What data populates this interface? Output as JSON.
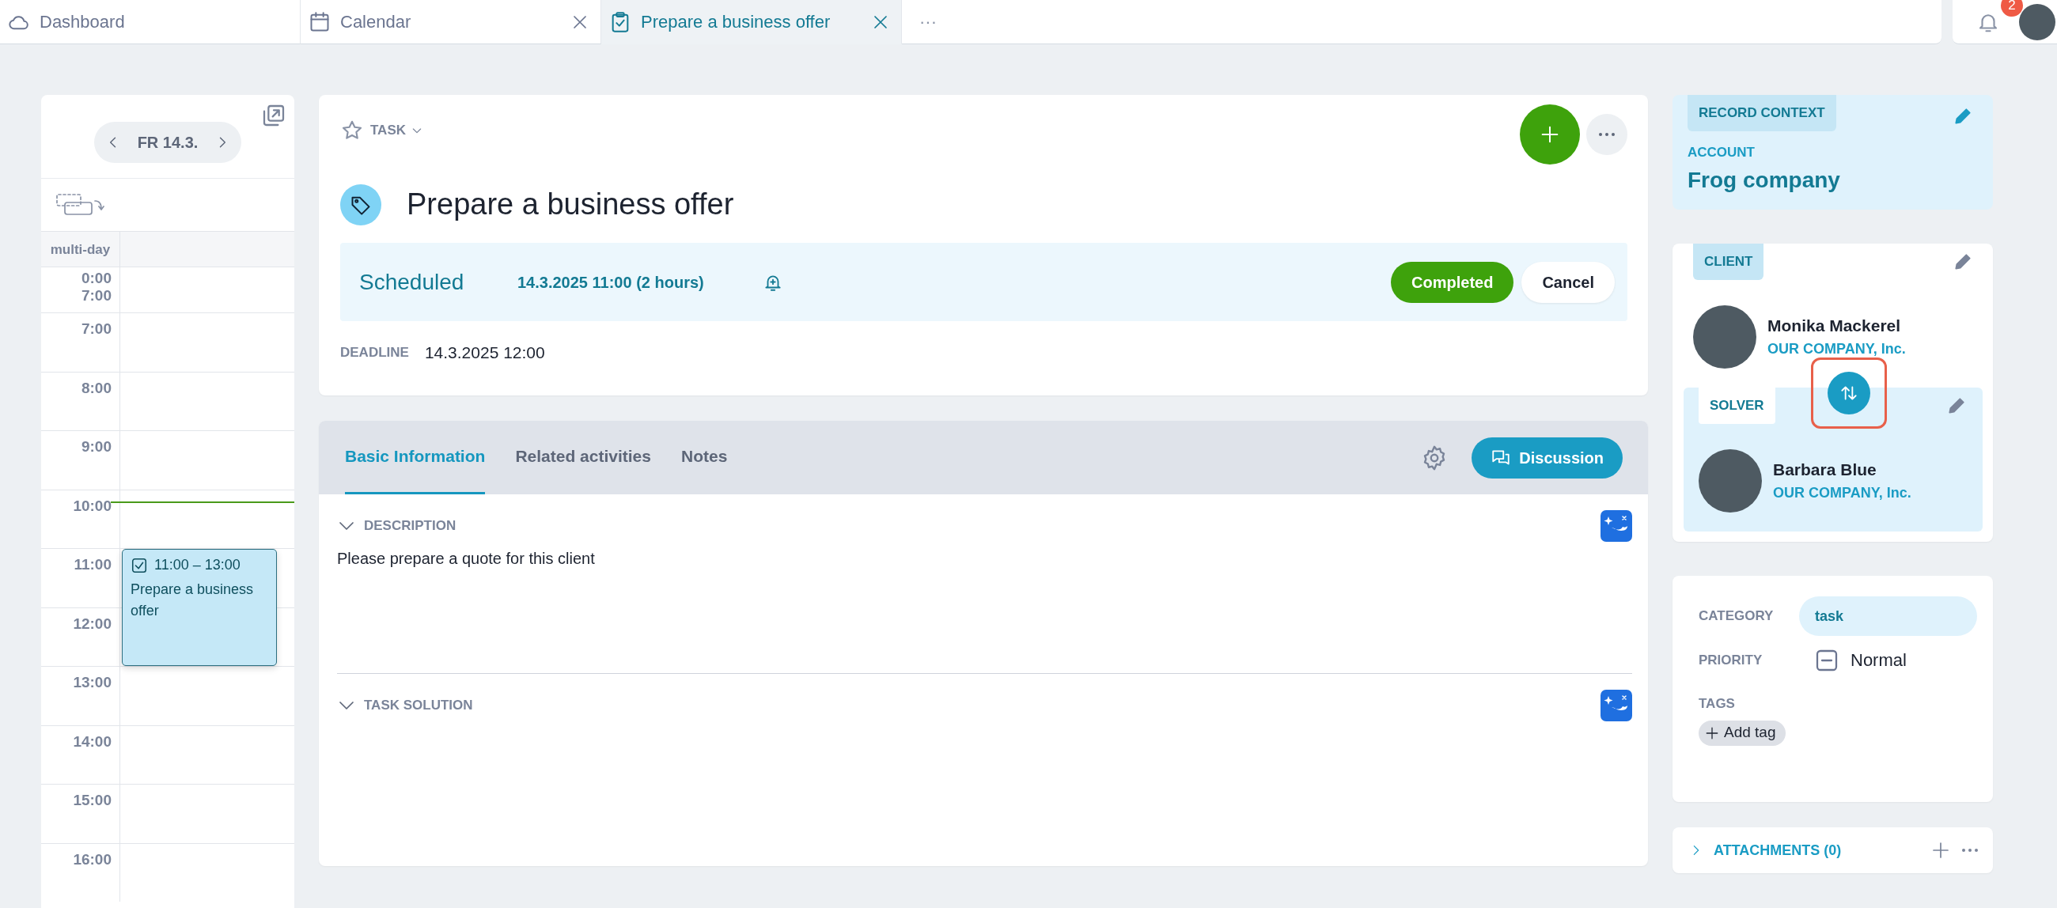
{
  "tabs": [
    {
      "label": "Dashboard",
      "kind": "dashboard",
      "closable": false,
      "selected": false
    },
    {
      "label": "Calendar",
      "kind": "calendar",
      "closable": true,
      "selected": false
    },
    {
      "label": "Prepare a business offer",
      "kind": "task",
      "closable": true,
      "selected": true
    }
  ],
  "more_tabs": "···",
  "notifications": {
    "count": "2"
  },
  "calendar": {
    "date": "FR 14.3.",
    "multi_day_label": "multi-day",
    "collapsed_labels": [
      "0:00",
      "7:00"
    ],
    "hours": [
      {
        "label": "7:00",
        "now": false
      },
      {
        "label": "8:00",
        "now": false
      },
      {
        "label": "9:00",
        "now": false
      },
      {
        "label": "10:00",
        "now": true
      },
      {
        "label": "11:00",
        "now": false,
        "events": [
          {
            "time": "11:00 – 13:00",
            "title": "Prepare a business offer"
          }
        ]
      },
      {
        "label": "12:00",
        "now": false
      },
      {
        "label": "13:00",
        "now": false
      },
      {
        "label": "14:00",
        "now": false
      },
      {
        "label": "15:00",
        "now": false
      },
      {
        "label": "16:00",
        "now": false
      }
    ]
  },
  "task": {
    "type": "TASK",
    "starred": false,
    "title": "Prepare a business offer",
    "status": "Scheduled",
    "schedule": "14.3.2025 11:00 (2 hours)",
    "actions": [
      {
        "label": "Completed",
        "kind": "primary"
      },
      {
        "label": "Cancel",
        "kind": "secondary"
      }
    ],
    "deadline_label": "DEADLINE",
    "deadline": "14.3.2025 12:00"
  },
  "detail_tabs": [
    {
      "label": "Basic Information",
      "selected": true
    },
    {
      "label": "Related activities",
      "selected": false
    },
    {
      "label": "Notes",
      "selected": false
    }
  ],
  "discussion": "Discussion",
  "sections": [
    {
      "title": "DESCRIPTION",
      "expanded": true,
      "text": "Please prepare a quote for this client"
    },
    {
      "title": "TASK SOLUTION",
      "expanded": true
    }
  ],
  "record_context": {
    "label": "RECORD CONTEXT",
    "account_label": "ACCOUNT",
    "account": "Frog company"
  },
  "client": {
    "label": "CLIENT",
    "name": "Monika Mackerel",
    "company": "OUR COMPANY, Inc."
  },
  "solver": {
    "label": "SOLVER",
    "name": "Barbara Blue",
    "company": "OUR COMPANY, Inc."
  },
  "attributes": {
    "category_label": "CATEGORY",
    "category": "task",
    "priority_label": "PRIORITY",
    "priority": "Normal",
    "tags_label": "TAGS",
    "add_tag": "Add tag"
  },
  "attachments": {
    "label": "ATTACHMENTS (0)",
    "expanded": false
  }
}
